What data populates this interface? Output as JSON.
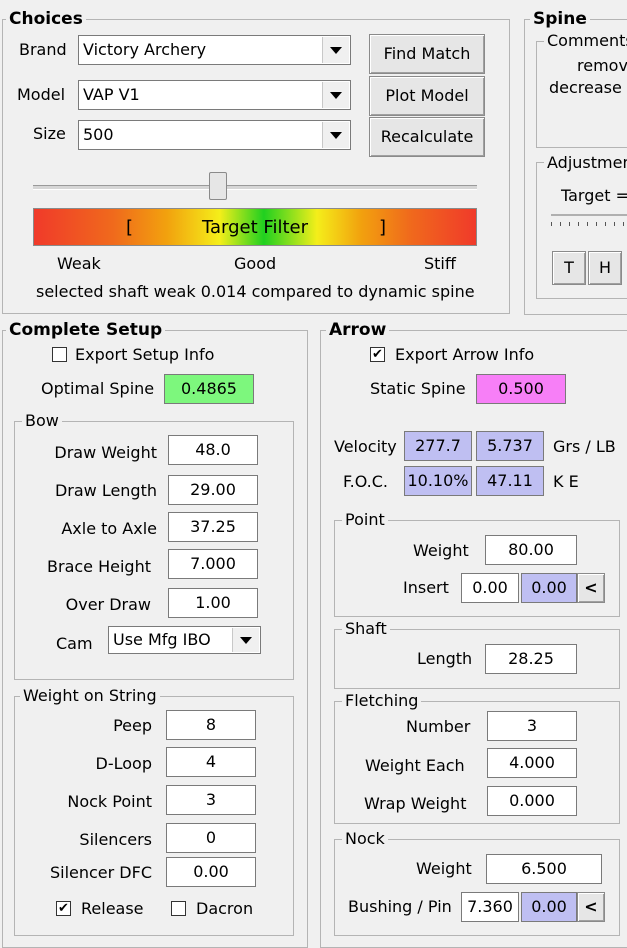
{
  "choices": {
    "title": "Choices",
    "brand_label": "Brand",
    "brand_value": "Victory Archery",
    "model_label": "Model",
    "model_value": "VAP V1",
    "size_label": "Size",
    "size_value": "500",
    "find_match": "Find Match",
    "plot_model": "Plot Model",
    "recalculate": "Recalculate",
    "filter_label": "Target Filter",
    "bracket_left": "[",
    "bracket_right": "]",
    "weak": "Weak",
    "good": "Good",
    "stiff": "Stiff",
    "status": "selected shaft weak 0.014 compared to dynamic spine"
  },
  "spine": {
    "title": "Spine",
    "comments_title": "Comments",
    "comment_line1": "remov",
    "comment_line2": "decrease",
    "adjust_title": "Adjustmen",
    "target_label": "Target =",
    "btn_t": "T",
    "btn_h": "H"
  },
  "setup": {
    "title": "Complete Setup",
    "export_label": "Export Setup Info",
    "export_checked": false,
    "optimal_label": "Optimal Spine",
    "optimal_value": "0.4865"
  },
  "bow": {
    "title": "Bow",
    "draw_weight_label": "Draw Weight",
    "draw_weight": "48.0",
    "draw_length_label": "Draw Length",
    "draw_length": "29.00",
    "axle_label": "Axle to Axle",
    "axle": "37.25",
    "brace_label": "Brace Height",
    "brace": "7.000",
    "overdraw_label": "Over Draw",
    "overdraw": "1.00",
    "cam_label": "Cam",
    "cam_value": "Use Mfg IBO"
  },
  "string": {
    "title": "Weight on String",
    "peep_label": "Peep",
    "peep": "8",
    "dloop_label": "D-Loop",
    "dloop": "4",
    "nock_label": "Nock Point",
    "nock": "3",
    "silencers_label": "Silencers",
    "silencers": "0",
    "dfc_label": "Silencer DFC",
    "dfc": "0.00",
    "release_label": "Release",
    "release_checked": true,
    "dacron_label": "Dacron",
    "dacron_checked": false
  },
  "arrow": {
    "title": "Arrow",
    "export_label": "Export Arrow Info",
    "export_checked": true,
    "static_label": "Static Spine",
    "static_value": "0.500",
    "velocity_label": "Velocity",
    "velocity_value": "277.7",
    "grs_value": "5.737",
    "grs_label": "Grs / LB",
    "foc_label": "F.O.C.",
    "foc_value": "10.10%",
    "ke_value": "47.11",
    "ke_label": "K E"
  },
  "point": {
    "title": "Point",
    "weight_label": "Weight",
    "weight": "80.00",
    "insert_label": "Insert",
    "insert": "0.00",
    "insert_calc": "0.00",
    "arrow_btn": "<"
  },
  "shaft": {
    "title": "Shaft",
    "length_label": "Length",
    "length": "28.25"
  },
  "fletching": {
    "title": "Fletching",
    "number_label": "Number",
    "number": "3",
    "weight_each_label": "Weight Each",
    "weight_each": "4.000",
    "wrap_label": "Wrap Weight",
    "wrap": "0.000"
  },
  "nock": {
    "title": "Nock",
    "weight_label": "Weight",
    "weight": "6.500",
    "bushing_label": "Bushing / Pin",
    "bushing": "7.360",
    "bushing_calc": "0.00",
    "arrow_btn": "<"
  }
}
